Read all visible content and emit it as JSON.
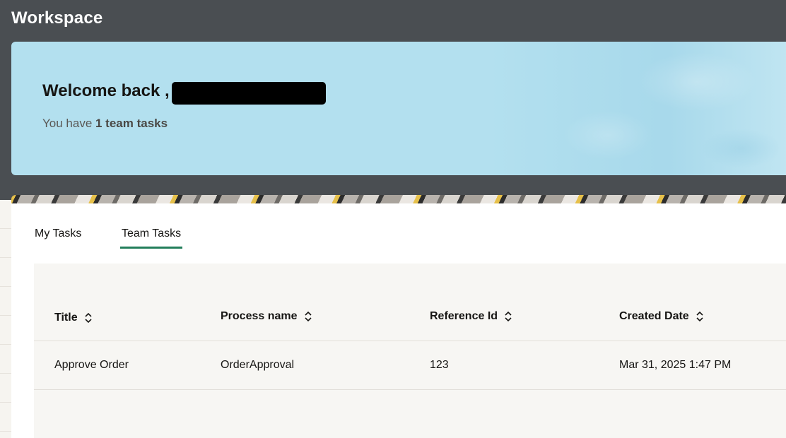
{
  "header": {
    "title": "Workspace"
  },
  "welcome": {
    "greeting": "Welcome back ,",
    "summary_prefix": "You have ",
    "summary_count_text": "1 team tasks"
  },
  "tabs": [
    {
      "label": "My Tasks",
      "selected": false
    },
    {
      "label": "Team Tasks",
      "selected": true
    }
  ],
  "table": {
    "columns": [
      "Title",
      "Process name",
      "Reference Id",
      "Created Date"
    ],
    "rows": [
      [
        "Approve Order",
        "OrderApproval",
        "123",
        "Mar 31, 2025 1:47 PM"
      ]
    ]
  },
  "colors": {
    "header_bg": "#4a4e52",
    "welcome_bg": "#b3e0ef",
    "tab_underline": "#227e5b",
    "table_bg": "#f7f6f3"
  },
  "icons": {
    "sort": "sort-arrows-icon"
  }
}
